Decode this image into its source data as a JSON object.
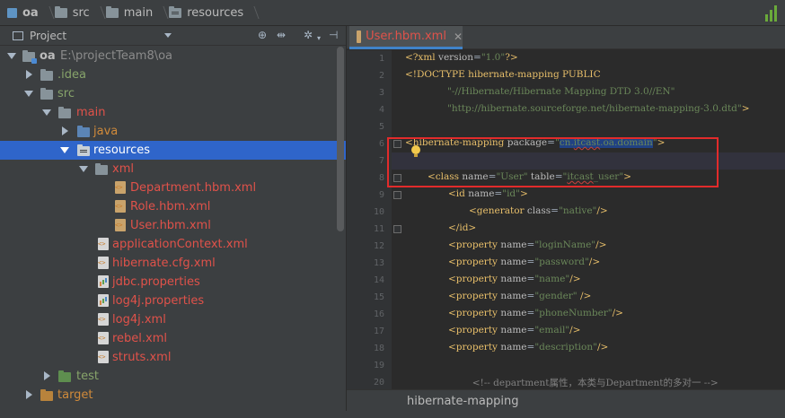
{
  "nav": {
    "crumbs": [
      "oa",
      "src",
      "main",
      "resources"
    ]
  },
  "project_panel": {
    "title": "Project",
    "tree": [
      {
        "name": "oa",
        "extra": "E:\\projectTeam8\\oa",
        "depth": 0,
        "expanded": true,
        "kind": "module"
      },
      {
        "name": ".idea",
        "depth": 1,
        "expanded": false,
        "kind": "folder",
        "color": "green"
      },
      {
        "name": "src",
        "depth": 1,
        "expanded": true,
        "kind": "folder",
        "color": "green"
      },
      {
        "name": "main",
        "depth": 2,
        "expanded": true,
        "kind": "folder",
        "color": "red"
      },
      {
        "name": "java",
        "depth": 3,
        "expanded": false,
        "kind": "folder",
        "color": "orange"
      },
      {
        "name": "resources",
        "depth": 3,
        "expanded": true,
        "kind": "folder",
        "color": "normal",
        "selected": true
      },
      {
        "name": "xml",
        "depth": 4,
        "expanded": true,
        "kind": "folder",
        "color": "red"
      },
      {
        "name": "Department.hbm.xml",
        "depth": 5,
        "kind": "hbm",
        "color": "red"
      },
      {
        "name": "Role.hbm.xml",
        "depth": 5,
        "kind": "hbm",
        "color": "red"
      },
      {
        "name": "User.hbm.xml",
        "depth": 5,
        "kind": "hbm",
        "color": "red"
      },
      {
        "name": "applicationContext.xml",
        "depth": 4,
        "kind": "xml",
        "color": "red"
      },
      {
        "name": "hibernate.cfg.xml",
        "depth": 4,
        "kind": "xml",
        "color": "red"
      },
      {
        "name": "jdbc.properties",
        "depth": 4,
        "kind": "props",
        "color": "red"
      },
      {
        "name": "log4j.properties",
        "depth": 4,
        "kind": "props",
        "color": "red"
      },
      {
        "name": "log4j.xml",
        "depth": 4,
        "kind": "xml",
        "color": "red"
      },
      {
        "name": "rebel.xml",
        "depth": 4,
        "kind": "xml",
        "color": "red"
      },
      {
        "name": "struts.xml",
        "depth": 4,
        "kind": "xml",
        "color": "red"
      },
      {
        "name": "test",
        "depth": 2,
        "expanded": false,
        "kind": "folder",
        "color": "green"
      },
      {
        "name": "target",
        "depth": 1,
        "expanded": false,
        "kind": "folder",
        "color": "orange"
      }
    ]
  },
  "editor": {
    "tab_label": "User.hbm.xml",
    "bottom_breadcrumb": "hibernate-mapping",
    "lines": [
      {
        "n": "1",
        "t": "<?xml version=\"1.0\"?>"
      },
      {
        "n": "2",
        "t": "<!DOCTYPE hibernate-mapping PUBLIC"
      },
      {
        "n": "3",
        "t": "        \"-//Hibernate/Hibernate Mapping DTD 3.0//EN\""
      },
      {
        "n": "4",
        "t": "        \"http://hibernate.sourceforge.net/hibernate-mapping-3.0.dtd\">"
      },
      {
        "n": "5",
        "t": ""
      },
      {
        "n": "6",
        "t": "<hibernate-mapping package=\"cn.itcast.oa.domain\">"
      },
      {
        "n": "7",
        "t": ""
      },
      {
        "n": "8",
        "t": "    <class name=\"User\" table=\"itcast_user\">"
      },
      {
        "n": "9",
        "t": "        <id name=\"id\">"
      },
      {
        "n": "10",
        "t": "            <generator class=\"native\"/>"
      },
      {
        "n": "11",
        "t": "        </id>"
      },
      {
        "n": "12",
        "t": "        <property name=\"loginName\"/>"
      },
      {
        "n": "13",
        "t": "        <property name=\"password\"/>"
      },
      {
        "n": "14",
        "t": "        <property name=\"name\"/>"
      },
      {
        "n": "15",
        "t": "        <property name=\"gender\" />"
      },
      {
        "n": "16",
        "t": "        <property name=\"phoneNumber\"/>"
      },
      {
        "n": "17",
        "t": "        <property name=\"email\"/>"
      },
      {
        "n": "18",
        "t": "        <property name=\"description\"/>"
      },
      {
        "n": "19",
        "t": ""
      },
      {
        "n": "20",
        "t": "        <!-- department属性，本类与Department的多对一 -->"
      }
    ]
  }
}
